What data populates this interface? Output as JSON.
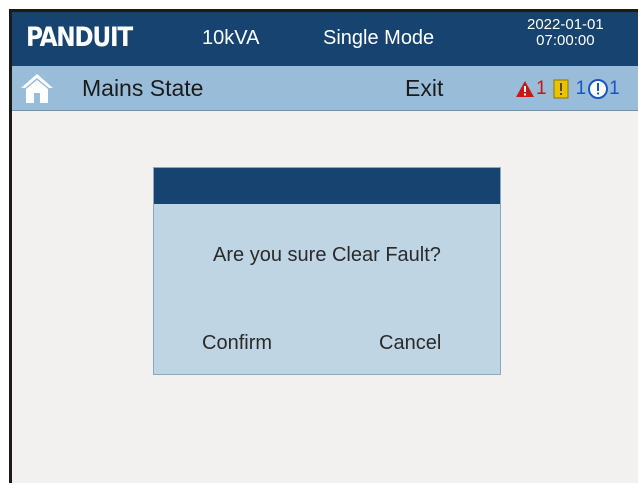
{
  "header": {
    "logo_text": "PANDUIT",
    "capacity": "10kVA",
    "mode": "Single Mode",
    "date": "2022-01-01",
    "time": "07:00:00"
  },
  "titlebar": {
    "home_icon": "home-icon",
    "title": "Mains State",
    "exit_label": "Exit",
    "alarms": [
      {
        "icon": "warning-triangle-icon",
        "color": "#c61818",
        "count": "1"
      },
      {
        "icon": "yellow-alert-icon",
        "color": "#e8c400",
        "count": "1"
      },
      {
        "icon": "info-circle-icon",
        "color": "#1a55c4",
        "count": "1"
      }
    ]
  },
  "dialog": {
    "message": "Are you sure Clear Fault?",
    "confirm_label": "Confirm",
    "cancel_label": "Cancel"
  },
  "colors": {
    "header_bg": "#174370",
    "titlebar_bg": "#99bdd9",
    "content_bg": "#f2f1f0",
    "dialog_bg": "#c0d5e3"
  }
}
